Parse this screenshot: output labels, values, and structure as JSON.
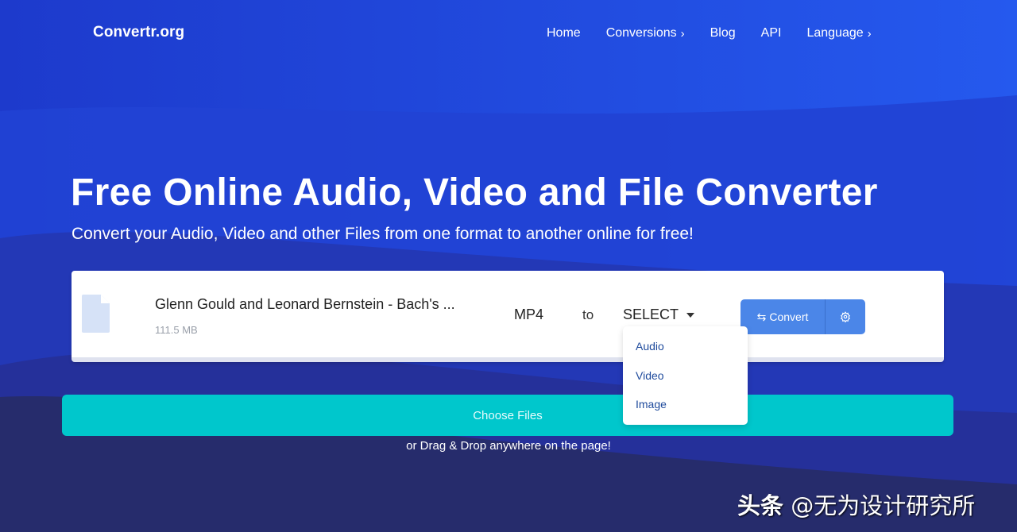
{
  "brand": {
    "logo": "Convertr.org"
  },
  "nav": {
    "items": [
      {
        "label": "Home",
        "has_chevron": false
      },
      {
        "label": "Conversions",
        "has_chevron": true
      },
      {
        "label": "Blog",
        "has_chevron": false
      },
      {
        "label": "API",
        "has_chevron": false
      },
      {
        "label": "Language",
        "has_chevron": true
      }
    ],
    "chevron": "›"
  },
  "hero": {
    "title": "Free Online Audio, Video and File Converter",
    "subtitle": "Convert your Audio, Video and other Files from one format to another online for free!"
  },
  "file": {
    "icon": "file-icon",
    "name": "Glenn Gould and Leonard Bernstein - Bach's ...",
    "size": "111.5 MB",
    "from_format": "MP4",
    "to_label": "to",
    "select_label": "SELECT",
    "convert_label": "Convert",
    "convert_icon": "swap-arrows-icon",
    "settings_icon": "gear-icon"
  },
  "dropdown": {
    "options": [
      "Audio",
      "Video",
      "Image"
    ]
  },
  "upload": {
    "choose_label": "Choose Files",
    "drag_text": "or Drag & Drop anywhere on the page!"
  },
  "watermark": {
    "prefix": "头条",
    "handle": "@无为设计研究所"
  },
  "colors": {
    "background_top": "#2152e6",
    "background_bottom": "#262c6c",
    "accent_teal": "#00c7cc",
    "convert_button": "#4b86e8",
    "dropdown_text": "#1e4a9c"
  }
}
